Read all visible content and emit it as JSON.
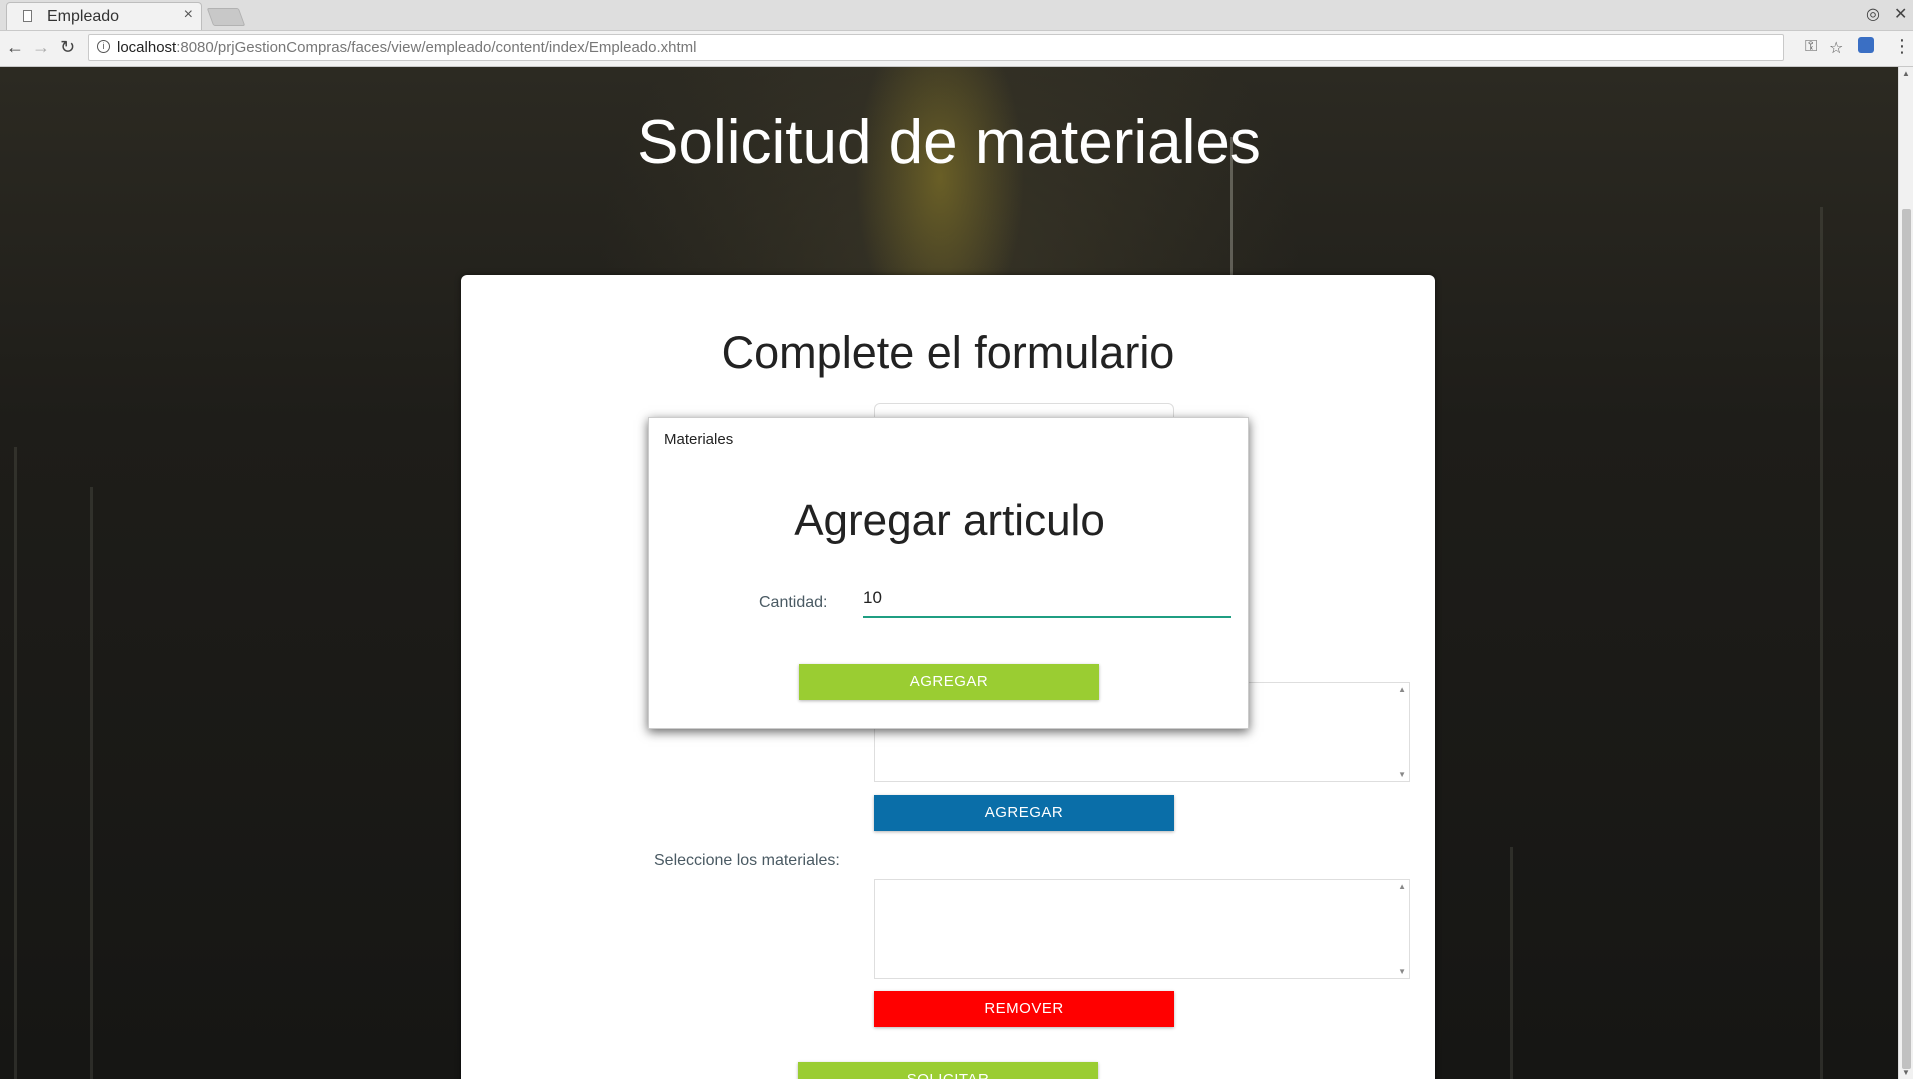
{
  "browser": {
    "tab_title": "Empleado",
    "tab_close": "×",
    "url_host": "localhost",
    "url_rest": ":8080/prjGestionCompras/faces/view/empleado/content/index/Empleado.xhtml"
  },
  "page": {
    "title": "Solicitud de materiales"
  },
  "form": {
    "title": "Complete el formulario",
    "add_button": "AGREGAR",
    "select_label": "Seleccione los materiales:",
    "remove_button": "REMOVER",
    "submit_button": "SOLICITAR"
  },
  "dialog": {
    "header": "Materiales",
    "title": "Agregar articulo",
    "quantity_label": "Cantidad:",
    "quantity_value": "10",
    "add_button": "AGREGAR"
  },
  "colors": {
    "green_button": "#9acd32",
    "blue_button": "#0a6ea8",
    "red_button": "#ff0000",
    "input_underline": "#1f9e82"
  }
}
